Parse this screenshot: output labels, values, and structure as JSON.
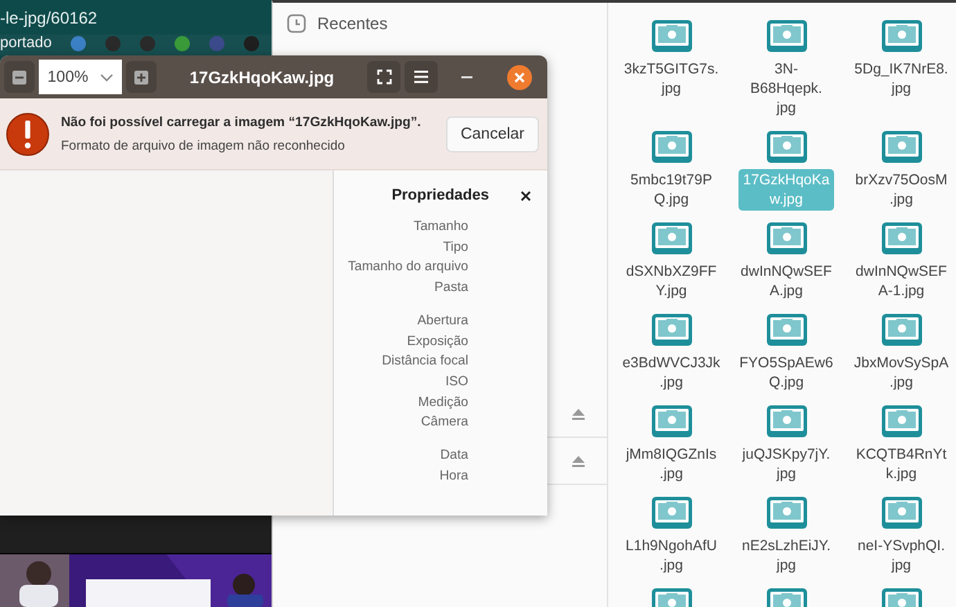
{
  "browser": {
    "url": "-le-jpg/60162",
    "bookmarks": [
      {
        "kind": "text",
        "label": "portado"
      },
      {
        "kind": "favicon",
        "color": "#3b7fc4"
      },
      {
        "kind": "favicon",
        "color": "#2a2a2a"
      },
      {
        "kind": "favicon",
        "color": "#2a2a2a"
      },
      {
        "kind": "favicon",
        "color": "#3a9a3a"
      },
      {
        "kind": "favicon",
        "color": "#3b4a8a"
      },
      {
        "kind": "favicon",
        "color": "#1f1f1f"
      }
    ]
  },
  "file_chooser": {
    "sidebar": {
      "items": [
        {
          "kind": "place",
          "label": "Recentes"
        },
        {
          "kind": "volume"
        },
        {
          "kind": "volume"
        }
      ]
    },
    "files": [
      {
        "kind": "file",
        "lines": [
          "3kzT5GITG7s.",
          "jpg"
        ],
        "selected": false
      },
      {
        "kind": "file",
        "lines": [
          "3N-",
          "B68Hqepk.",
          "jpg"
        ],
        "selected": false
      },
      {
        "kind": "file",
        "lines": [
          "5Dg_IK7NrE8.",
          "jpg"
        ],
        "selected": false
      },
      {
        "kind": "file",
        "lines": [
          "5mbc19t79P",
          "Q.jpg"
        ],
        "selected": false
      },
      {
        "kind": "file",
        "lines": [
          "17GzkHqoKa",
          "w.jpg"
        ],
        "selected": true
      },
      {
        "kind": "file",
        "lines": [
          "brXzv75OosM",
          ".jpg"
        ],
        "selected": false
      },
      {
        "kind": "file",
        "lines": [
          "dSXNbXZ9FF",
          "Y.jpg"
        ],
        "selected": false
      },
      {
        "kind": "file",
        "lines": [
          "dwInNQwSEF",
          "A.jpg"
        ],
        "selected": false
      },
      {
        "kind": "file",
        "lines": [
          "dwInNQwSEF",
          "A-1.jpg"
        ],
        "selected": false
      },
      {
        "kind": "file",
        "lines": [
          "e3BdWVCJ3Jk",
          ".jpg"
        ],
        "selected": false
      },
      {
        "kind": "file",
        "lines": [
          "FYO5SpAEw6",
          "Q.jpg"
        ],
        "selected": false
      },
      {
        "kind": "file",
        "lines": [
          "JbxMovSySpA",
          ".jpg"
        ],
        "selected": false
      },
      {
        "kind": "file",
        "lines": [
          "jMm8IQGZnIs",
          ".jpg"
        ],
        "selected": false
      },
      {
        "kind": "file",
        "lines": [
          "juQJSKpy7jY.",
          "jpg"
        ],
        "selected": false
      },
      {
        "kind": "file",
        "lines": [
          "KCQTB4RnYt",
          "k.jpg"
        ],
        "selected": false
      },
      {
        "kind": "file",
        "lines": [
          "L1h9NgohAfU",
          ".jpg"
        ],
        "selected": false
      },
      {
        "kind": "file",
        "lines": [
          "nE2sLzhEiJY.",
          "jpg"
        ],
        "selected": false
      },
      {
        "kind": "file",
        "lines": [
          "neI-YSvphQI.",
          "jpg"
        ],
        "selected": false
      },
      {
        "kind": "cut_off"
      },
      {
        "kind": "cut_off"
      },
      {
        "kind": "cut_off"
      }
    ]
  },
  "viewer": {
    "title": "17GzkHqoKaw.jpg",
    "zoom": "100%",
    "error": {
      "title": "Não foi possível carregar a imagem “17GzkHqoKaw.jpg”.",
      "message": "Formato de arquivo de imagem não reconhecido",
      "button": "Cancelar"
    },
    "properties": {
      "title": "Propriedades",
      "groups": [
        [
          "Tamanho",
          "Tipo",
          "Tamanho do arquivo",
          "Pasta"
        ],
        [
          "Abertura",
          "Exposição",
          "Distância focal",
          "ISO",
          "Medição",
          "Câmera"
        ],
        [
          "Data",
          "Hora"
        ]
      ]
    }
  }
}
